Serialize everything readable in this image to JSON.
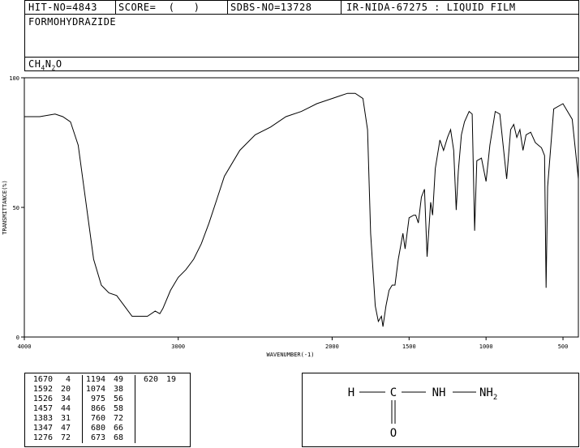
{
  "header": {
    "hit_no": "HIT-NO=4843",
    "score": "SCORE=  (   )",
    "sdbs_no": "SDBS-NO=13728",
    "ir_info": "IR-NIDA-67275 : LIQUID FILM"
  },
  "compound": {
    "name": "FORMOHYDRAZIDE",
    "formula_prefix": "CH",
    "formula_sub1": "4",
    "formula_mid": "N",
    "formula_sub2": "2",
    "formula_suffix": "O"
  },
  "chart_data": {
    "type": "line",
    "xlabel": "WAVENUMBER(-1)",
    "ylabel": "TRANSMITTANCE(%)",
    "xlim": [
      4000,
      400
    ],
    "ylim": [
      0,
      100
    ],
    "x_ticks": [
      4000,
      3000,
      2000,
      1500,
      1000,
      500
    ],
    "y_ticks": [
      0,
      50,
      100
    ],
    "series": [
      {
        "x": [
          4000,
          3900,
          3800,
          3750,
          3700,
          3650,
          3600,
          3550,
          3500,
          3450,
          3400,
          3350,
          3300,
          3250,
          3200,
          3150,
          3120,
          3100,
          3050,
          3000,
          2950,
          2900,
          2850,
          2800,
          2750,
          2700,
          2600,
          2500,
          2400,
          2300,
          2200,
          2100,
          2000,
          1950,
          1900,
          1850,
          1800,
          1770,
          1750,
          1720,
          1700,
          1680,
          1670,
          1650,
          1630,
          1610,
          1592,
          1570,
          1540,
          1526,
          1500,
          1470,
          1457,
          1440,
          1420,
          1400,
          1383,
          1360,
          1347,
          1330,
          1300,
          1276,
          1250,
          1230,
          1210,
          1194,
          1180,
          1160,
          1140,
          1110,
          1090,
          1074,
          1060,
          1030,
          1000,
          975,
          940,
          910,
          866,
          840,
          820,
          800,
          780,
          760,
          740,
          710,
          680,
          660,
          640,
          620,
          610,
          600,
          560,
          500,
          470,
          440,
          400
        ],
        "y": [
          85,
          85,
          86,
          85,
          83,
          74,
          52,
          30,
          20,
          17,
          16,
          12,
          8,
          8,
          8,
          10,
          9,
          11,
          18,
          23,
          26,
          30,
          36,
          44,
          53,
          62,
          72,
          78,
          81,
          85,
          87,
          90,
          92,
          93,
          94,
          94,
          92,
          80,
          40,
          12,
          6,
          8,
          4,
          12,
          18,
          20,
          20,
          30,
          40,
          34,
          46,
          47,
          47,
          44,
          54,
          57,
          31,
          52,
          47,
          65,
          76,
          72,
          77,
          80,
          72,
          49,
          64,
          78,
          83,
          87,
          86,
          41,
          68,
          69,
          60,
          74,
          87,
          86,
          61,
          80,
          82,
          77,
          80,
          72,
          78,
          79,
          75,
          74,
          73,
          70,
          19,
          58,
          88,
          90,
          87,
          84,
          61
        ]
      }
    ]
  },
  "peak_table": {
    "columns": [
      [
        [
          "1670",
          "4"
        ],
        [
          "1592",
          "20"
        ],
        [
          "1526",
          "34"
        ],
        [
          "1457",
          "44"
        ],
        [
          "1383",
          "31"
        ],
        [
          "1347",
          "47"
        ],
        [
          "1276",
          "72"
        ]
      ],
      [
        [
          "1194",
          "49"
        ],
        [
          "1074",
          "38"
        ],
        [
          "975",
          "56"
        ],
        [
          "866",
          "58"
        ],
        [
          "760",
          "72"
        ],
        [
          "680",
          "66"
        ],
        [
          "673",
          "68"
        ]
      ],
      [
        [
          "620",
          "19"
        ]
      ]
    ]
  },
  "structure": {
    "h": "H",
    "c": "C",
    "nh": "NH",
    "nh2_base": "NH",
    "nh2_sub": "2",
    "o": "O"
  }
}
